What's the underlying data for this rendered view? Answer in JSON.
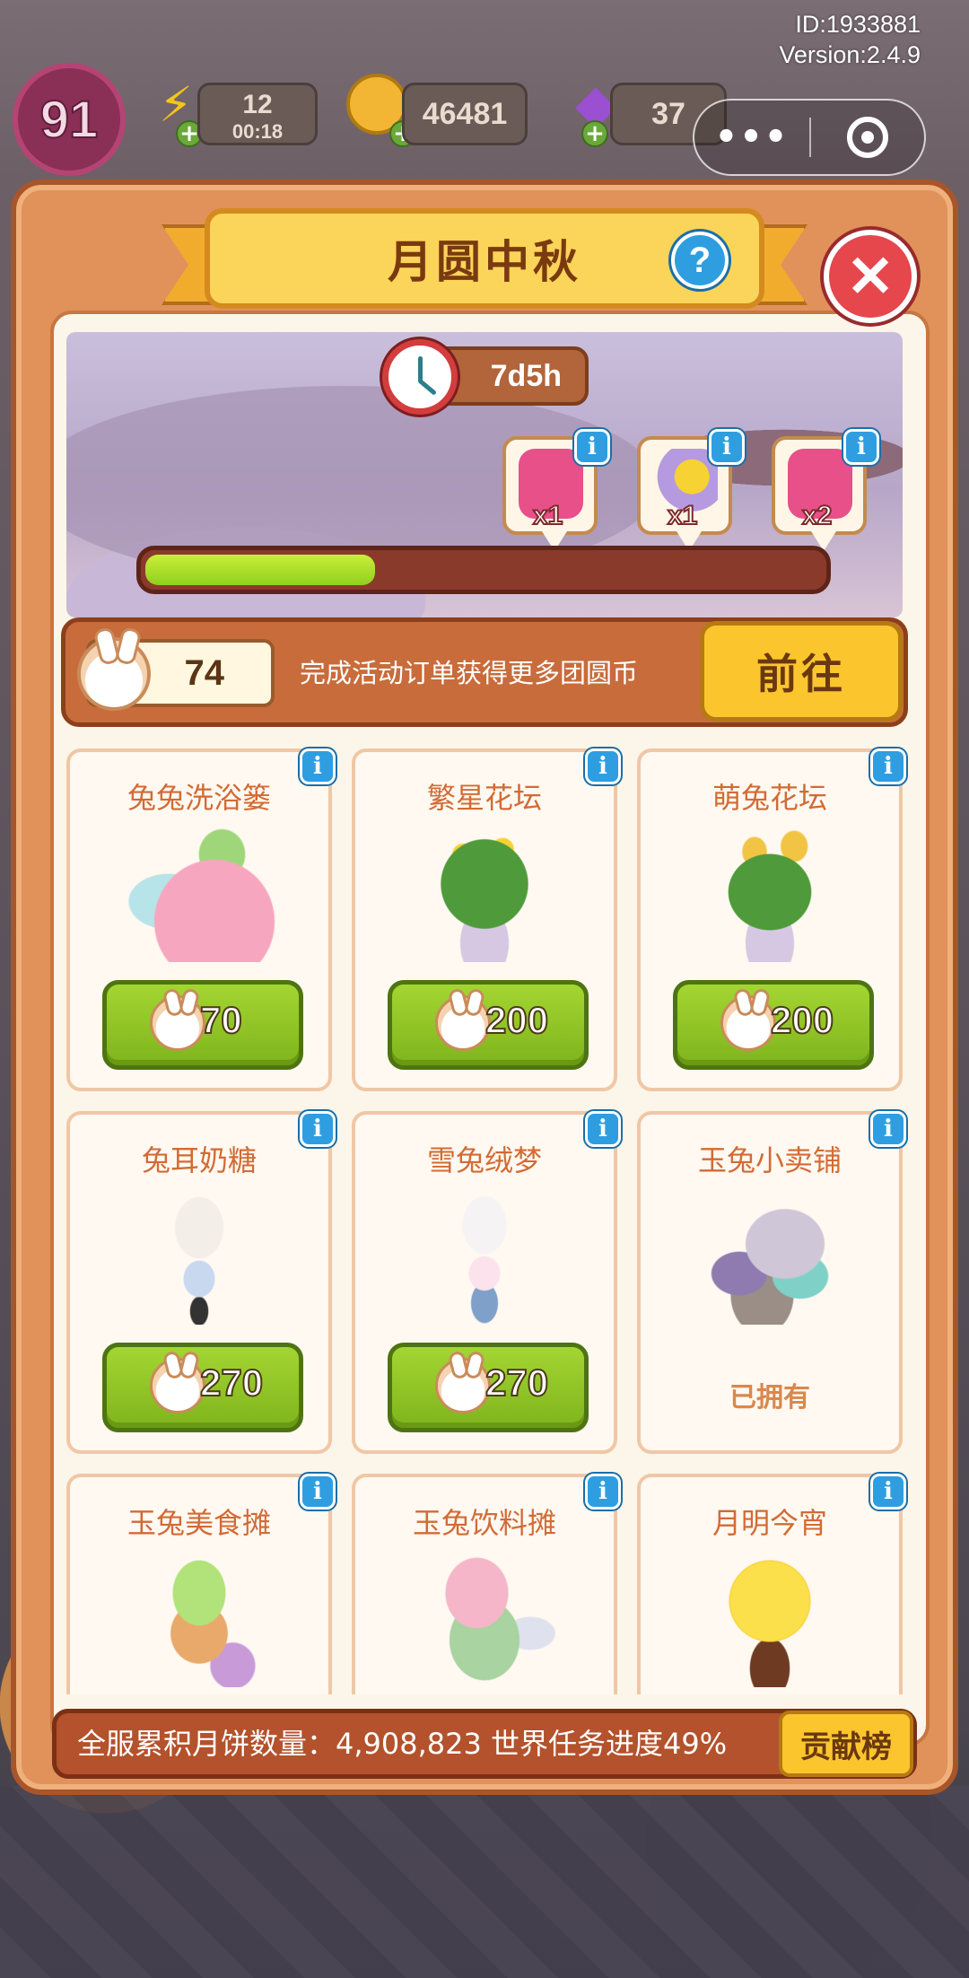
{
  "hud": {
    "id_text": "ID:1933881",
    "version_text": "Version:2.4.9",
    "level": "91",
    "energy": "12",
    "energy_timer": "00:18",
    "coins": "46481",
    "gems": "37",
    "menu_dots": "•••"
  },
  "event": {
    "title": "月圆中秋",
    "help": "?",
    "close": "✕",
    "timer": "7d5h",
    "progress": 0.34,
    "rewards": [
      {
        "qty": "x1",
        "icon": "pink-backpack-icon"
      },
      {
        "qty": "x1",
        "icon": "moon-decor-icon"
      },
      {
        "qty": "x2",
        "icon": "pink-backpack-icon"
      }
    ]
  },
  "currency": {
    "amount": "74",
    "hint": "完成活动订单获得更多团圆币",
    "go_label": "前往"
  },
  "items": [
    {
      "name": "兔兔洗浴篓",
      "price": "70",
      "art": "bath-basket"
    },
    {
      "name": "繁星花坛",
      "price": "200",
      "art": "star-flowerbed"
    },
    {
      "name": "萌兔花坛",
      "price": "200",
      "art": "bunny-flowerbed"
    },
    {
      "name": "兔耳奶糖",
      "price": "270",
      "art": "bunny-ear-girl"
    },
    {
      "name": "雪兔绒梦",
      "price": "270",
      "art": "snow-bunny-boy"
    },
    {
      "name": "玉兔小卖铺",
      "status": "已拥有",
      "art": "rabbit-shop"
    },
    {
      "name": "玉兔美食摊",
      "art": "food-stall"
    },
    {
      "name": "玉兔饮料摊",
      "art": "drink-stall"
    },
    {
      "name": "月明今宵",
      "art": "moon-lamp"
    }
  ],
  "world": {
    "text": "全服累积月饼数量：4,908,823  世界任务进度49%",
    "rank_label": "贡献榜"
  },
  "colors": {
    "panel": "#e0925a",
    "accent_green": "#8fc624",
    "accent_yellow": "#fbc52e",
    "title_text": "#7a3a10"
  }
}
